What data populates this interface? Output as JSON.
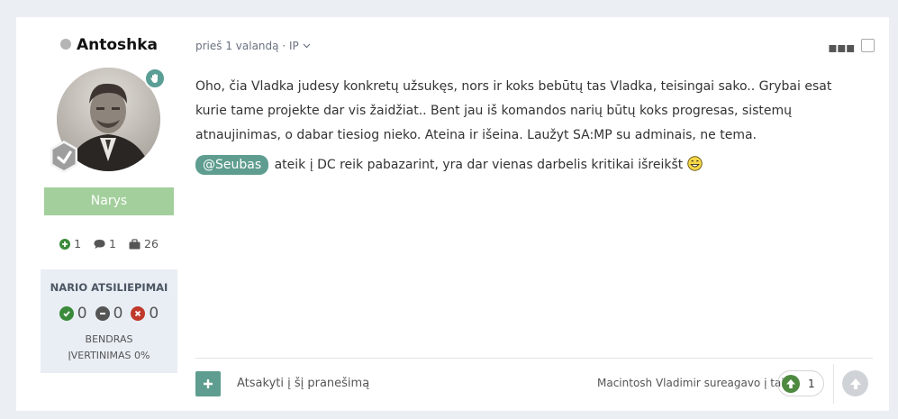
{
  "author": {
    "name": "Antoshka",
    "group": "Narys",
    "stats": {
      "reputation": "1",
      "comments": "1",
      "posts": "26"
    },
    "feedback": {
      "title": "NARIO ATSILIEPIMAI",
      "positive": "0",
      "neutral": "0",
      "negative": "0",
      "overall_line1": "BENDRAS",
      "overall_line2": "ĮVERTINIMAS 0%"
    }
  },
  "post": {
    "time": "prieš 1 valandą",
    "ip_label": "· IP",
    "paragraph1": "Oho, čia Vladka judesy konkretų užsukęs, nors ir koks bebūtų tas Vladka, teisingai sako.. Grybai esat kurie tame projekte dar vis žaidžiat.. Bent jau iš komandos narių būtų koks progresas, sistemų atnaujinimas, o dabar tiesiog nieko. Ateina ir išeina. Laužyt SA:MP su adminais, ne tema.",
    "mention": "@Seubas",
    "paragraph2": "ateik į DC reik pabazarint, yra dar vienas darbelis kritikai išreikšt"
  },
  "footer": {
    "reply_label": "Atsakyti į šį pranešimą",
    "reactions_text": "Macintosh Vladimir sureagavo į tai",
    "reaction_count": "1"
  },
  "colors": {
    "accent": "#5e9d8f",
    "group_badge": "#a3cf9c",
    "reaction_green": "#4e8a3f",
    "panel": "#e9eef4"
  }
}
